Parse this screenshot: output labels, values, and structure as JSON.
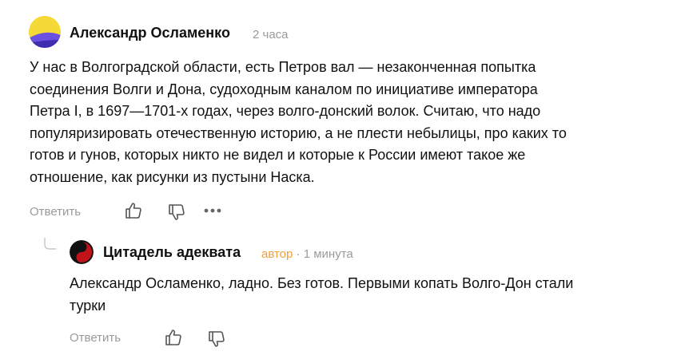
{
  "comment": {
    "author": "Александр Осламенко",
    "time": "2 часа",
    "lines": [
      "У нас в Волгоградской области, есть Петров вал — незаконченная попытка",
      "соединения Волги и Дона, судоходным каналом по инициативе императора",
      "Петра I, в 1697—1701-х годах, через волго-донский волок. Считаю, что надо",
      "популяризировать отечественную историю, а не плести небылицы, про каких то",
      "готов и гунов, которых никто не видел и которые к России имеют такое же",
      "отношение, как рисунки из пустыни Наска."
    ],
    "reply_label": "Ответить"
  },
  "reply": {
    "author": "Цитадель адеквата",
    "badge": "автор",
    "separator": "·",
    "time": "1 минута",
    "lines": [
      "Александр Осламенко, ладно. Без готов. Первыми копать Волго-Дон стали",
      "турки"
    ],
    "reply_label": "Ответить"
  },
  "colors": {
    "muted": "#9a9a9a",
    "author_badge": "#f29e39",
    "avatar_yellow": "#f5d936",
    "avatar_purple": "#6b4fe0"
  }
}
